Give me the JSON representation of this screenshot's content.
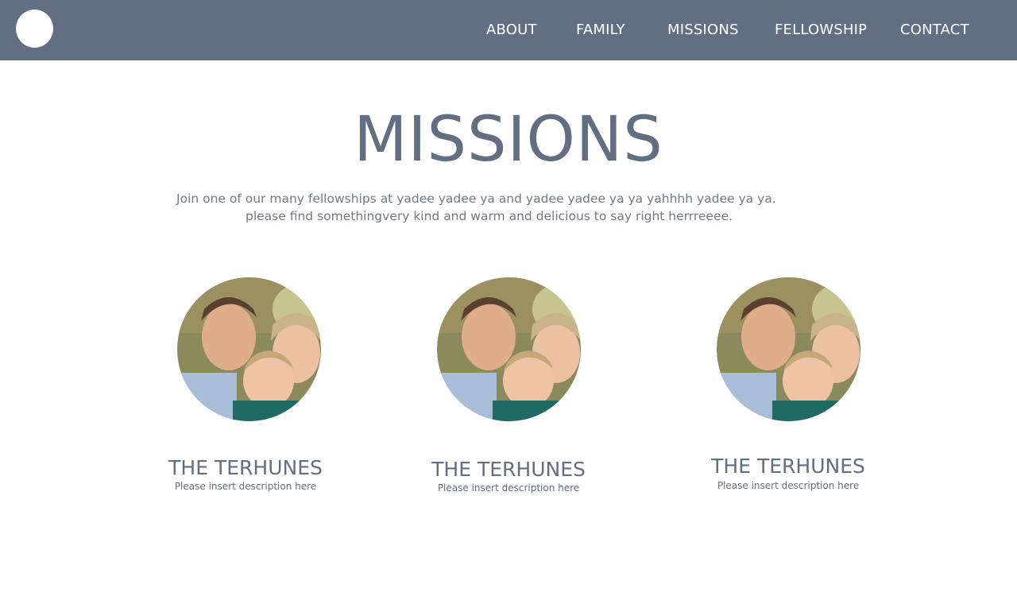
{
  "nav": {
    "about": "ABOUT",
    "family": "FAMILY",
    "missions": "MISSIONS",
    "fellowship": "FELLOWSHIP",
    "contact": "CONTACT"
  },
  "main": {
    "title": "MISSIONS",
    "intro_line1": "Join one of our many fellowships at yadee yadee ya and yadee yadee ya ya yahhhh yadee ya ya.",
    "intro_line2": "please find somethingvery kind and warm and delicious to say right herrreeee."
  },
  "cards": [
    {
      "name": "THE TERHUNES",
      "description": "Please insert description here"
    },
    {
      "name": "THE TERHUNES",
      "description": "Please insert description here"
    },
    {
      "name": "THE TERHUNES",
      "description": "Please insert description here"
    }
  ],
  "colors": {
    "nav_background": "#626e82",
    "accent_text": "#626e82"
  }
}
